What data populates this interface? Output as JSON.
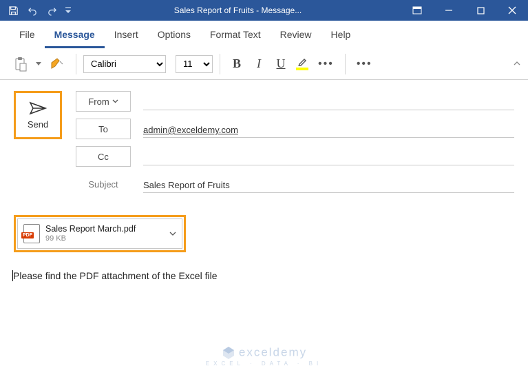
{
  "titlebar": {
    "title": "Sales Report of Fruits  -  Message..."
  },
  "menu": {
    "file": "File",
    "message": "Message",
    "insert": "Insert",
    "options": "Options",
    "format_text": "Format Text",
    "review": "Review",
    "help": "Help"
  },
  "ribbon": {
    "font_name": "Calibri",
    "font_size": "11",
    "bold": "B",
    "italic": "I",
    "underline": "U",
    "more": "•••",
    "more2": "•••"
  },
  "compose": {
    "send_label": "Send",
    "from_label": "From",
    "to_label": "To",
    "cc_label": "Cc",
    "subject_label": "Subject",
    "to_value": "admin@exceldemy.com",
    "subject_value": "Sales Report of Fruits"
  },
  "attachment": {
    "icon_tag": "PDF",
    "filename": "Sales Report March.pdf",
    "filesize": "99 KB"
  },
  "body": {
    "text": "Please find the PDF attachment of the Excel file"
  },
  "watermark": {
    "brand": "exceldemy",
    "sub": "EXCEL · DATA · BI"
  }
}
